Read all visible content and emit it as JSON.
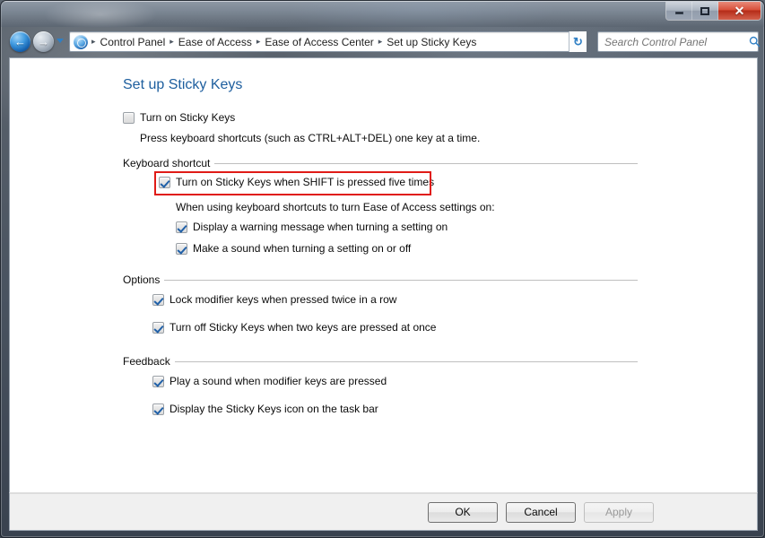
{
  "window": {
    "controls": {
      "minimize_label": "–",
      "maximize_label": "",
      "close_label": "✕"
    }
  },
  "navbar": {
    "back_arrow": "←",
    "forward_arrow": "→",
    "refresh_label": "↻",
    "breadcrumbs": [
      {
        "label": "Control Panel"
      },
      {
        "label": "Ease of Access"
      },
      {
        "label": "Ease of Access Center"
      },
      {
        "label": "Set up Sticky Keys"
      }
    ],
    "separator": "▸",
    "search": {
      "placeholder": "Search Control Panel",
      "value": ""
    }
  },
  "page": {
    "title": "Set up Sticky Keys",
    "accent_color": "#1d5e9e",
    "main_toggle": {
      "label": "Turn on Sticky Keys",
      "checked": false
    },
    "main_description": "Press keyboard shortcuts (such as CTRL+ALT+DEL) one key at a time.",
    "groups": [
      {
        "title": "Keyboard shortcut",
        "items": [
          {
            "label": "Turn on Sticky Keys when SHIFT is pressed five times",
            "checked": true
          },
          {
            "label": "Display a warning message when turning a setting on",
            "checked": true
          },
          {
            "label": "Make a sound when turning a setting on or off",
            "checked": true
          }
        ],
        "note": "When using keyboard shortcuts to turn Ease of Access settings on:"
      },
      {
        "title": "Options",
        "items": [
          {
            "label": "Lock modifier keys when pressed twice in a row",
            "checked": true
          },
          {
            "label": "Turn off Sticky Keys when two keys are pressed at once",
            "checked": true
          }
        ]
      },
      {
        "title": "Feedback",
        "items": [
          {
            "label": "Play a sound when modifier keys are pressed",
            "checked": true
          },
          {
            "label": "Display the Sticky Keys icon on the task bar",
            "checked": true
          }
        ]
      }
    ],
    "highlight_color": "#e01b17"
  },
  "footer": {
    "ok_label": "OK",
    "cancel_label": "Cancel",
    "apply_label": "Apply"
  }
}
